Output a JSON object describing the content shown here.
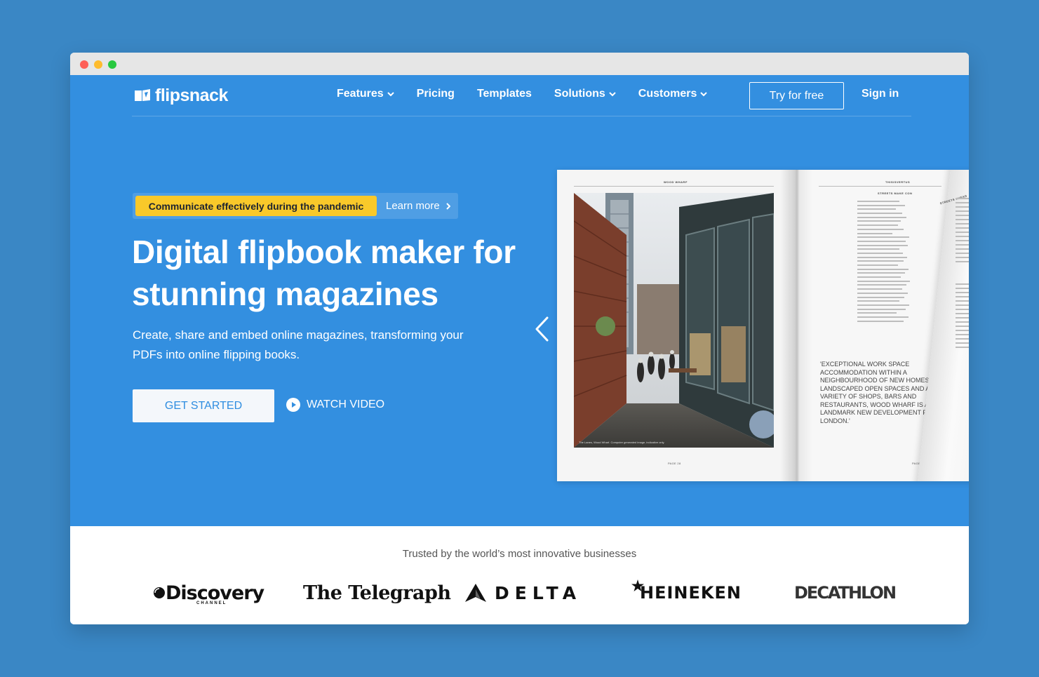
{
  "brand": {
    "name": "flipsnack"
  },
  "nav": {
    "items": [
      {
        "label": "Features",
        "dropdown": true
      },
      {
        "label": "Pricing",
        "dropdown": false
      },
      {
        "label": "Templates",
        "dropdown": false
      },
      {
        "label": "Solutions",
        "dropdown": true
      },
      {
        "label": "Customers",
        "dropdown": true
      }
    ],
    "try_label": "Try for free",
    "signin_label": "Sign in"
  },
  "announcement": {
    "tag": "Communicate effectively during the pandemic",
    "link": "Learn more"
  },
  "hero": {
    "headline": "Digital flipbook maker for stunning magazines",
    "subtitle": "Create, share and embed online magazines, transforming your PDFs into online flipping books.",
    "cta_primary": "GET STARTED",
    "cta_secondary": "WATCH VIDEO"
  },
  "flipbook": {
    "left_runhead": "WOOD WHARF",
    "right_runhead": "THISISVERTUS",
    "right_subhead": "STREETS MAKE CON",
    "curl_head": "STREETS AHEAD",
    "caption": "The Lanes, Wood Wharf. Computer generated image, indicative only.",
    "left_page_number": "PAGE 28",
    "right_page_number": "PAGE 29",
    "quote": "'EXCEPTIONAL WORK SPACE ACCOMMODATION WITHIN A NEIGHBOURHOOD OF NEW HOMES, LANDSCAPED OPEN SPACES AND A VARIETY OF SHOPS, BARS AND RESTAURANTS, WOOD WHARF IS A LANDMARK NEW DEVELOPMENT FOR LONDON.'"
  },
  "trusted": {
    "title": "Trusted by the world’s most innovative businesses",
    "logos": [
      "Discovery",
      "CHANNEL",
      "The Telegraph",
      "DELTA",
      "HEINEKEN",
      "DECATHLON"
    ]
  },
  "colors": {
    "background": "#3a87c5",
    "hero": "#338fe0",
    "tag": "#f9c92a",
    "button_text": "#2f8de0"
  }
}
